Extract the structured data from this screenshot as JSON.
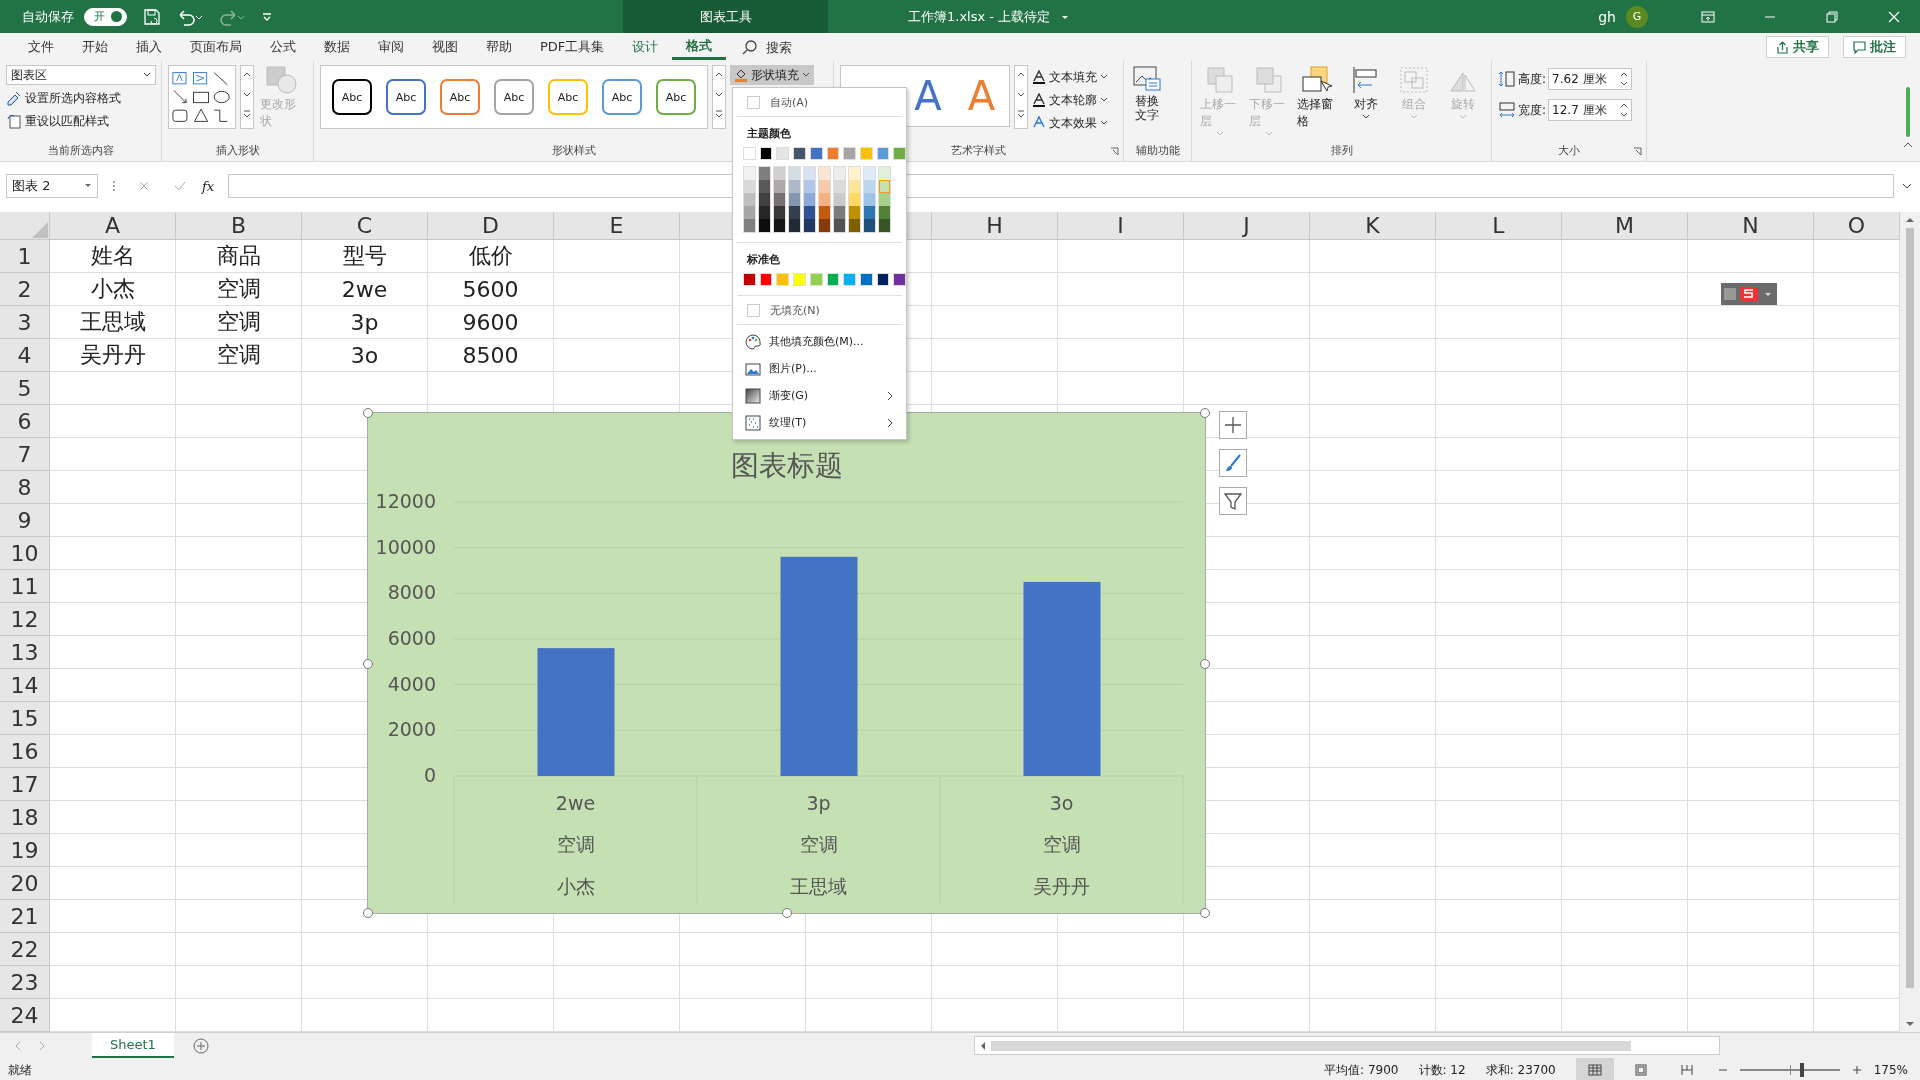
{
  "titlebar": {
    "autosave_label": "自动保存",
    "autosave": {
      "label": "开",
      "on": true
    },
    "context_label": "图表工具",
    "document_title": "工作簿1.xlsx - 上载待定",
    "user": "gh",
    "avatar": "G"
  },
  "menu_tabs": [
    {
      "label": "文件",
      "selected": false,
      "kind": "normal"
    },
    {
      "label": "开始",
      "selected": false,
      "kind": "normal"
    },
    {
      "label": "插入",
      "selected": false,
      "kind": "normal"
    },
    {
      "label": "页面布局",
      "selected": false,
      "kind": "normal"
    },
    {
      "label": "公式",
      "selected": false,
      "kind": "normal"
    },
    {
      "label": "数据",
      "selected": false,
      "kind": "normal"
    },
    {
      "label": "审阅",
      "selected": false,
      "kind": "normal"
    },
    {
      "label": "视图",
      "selected": false,
      "kind": "normal"
    },
    {
      "label": "帮助",
      "selected": false,
      "kind": "normal"
    },
    {
      "label": "PDF工具集",
      "selected": false,
      "kind": "normal"
    },
    {
      "label": "设计",
      "selected": false,
      "kind": "context"
    },
    {
      "label": "格式",
      "selected": true,
      "kind": "context"
    }
  ],
  "search": {
    "placeholder": "搜索"
  },
  "header_buttons": [
    {
      "label": "共享",
      "kind": "share"
    },
    {
      "label": "批注",
      "kind": "comment"
    }
  ],
  "ribbon": {
    "selection": {
      "dropdown": "图表区",
      "items": [
        "设置所选内容格式",
        "重设以匹配样式"
      ],
      "label": "当前所选内容"
    },
    "insert_shapes": {
      "change_shape": {
        "label": "更改形状",
        "disabled": true
      },
      "label": "插入形状"
    },
    "shape_styles": {
      "swatches": [
        {
          "label": "Abc",
          "color": "#000000"
        },
        {
          "label": "Abc",
          "color": "#4472c4"
        },
        {
          "label": "Abc",
          "color": "#ed7d31"
        },
        {
          "label": "Abc",
          "color": "#a5a5a5"
        },
        {
          "label": "Abc",
          "color": "#ffc000"
        },
        {
          "label": "Abc",
          "color": "#5b9bd5"
        },
        {
          "label": "Abc",
          "color": "#70ad47"
        }
      ],
      "fill_button": {
        "label": "形状填充",
        "expanded": true
      },
      "label": "形状样式"
    },
    "wordart": {
      "letters": [
        {
          "label": "A",
          "color": "#4472c4"
        },
        {
          "label": "A",
          "color": "#ed7d31"
        }
      ],
      "items": [
        "文本填充",
        "文本轮廓",
        "文本效果"
      ],
      "label": "艺术字样式"
    },
    "accessibility": {
      "button": "替换文字",
      "label": "辅助功能"
    },
    "arrange": {
      "buttons": [
        {
          "label": "上移一层",
          "disabled": true,
          "kind": "forward"
        },
        {
          "label": "下移一层",
          "disabled": true,
          "kind": "backward"
        },
        {
          "label": "选择窗格",
          "disabled": false,
          "kind": "pane"
        },
        {
          "label": "对齐",
          "disabled": false,
          "kind": "align"
        },
        {
          "label": "组合",
          "disabled": true,
          "kind": "group"
        },
        {
          "label": "旋转",
          "disabled": true,
          "kind": "rotate"
        }
      ],
      "label": "排列"
    },
    "size": {
      "fields": [
        {
          "label": "高度:",
          "value": "7.62 厘米",
          "kind": "height"
        },
        {
          "label": "宽度:",
          "value": "12.7 厘米",
          "kind": "width"
        }
      ],
      "label": "大小"
    }
  },
  "formula_bar": {
    "name_box": "图表 2",
    "fx": "fx"
  },
  "sheet": {
    "columns": [
      "A",
      "B",
      "C",
      "D",
      "E",
      "H",
      "I",
      "J",
      "K",
      "L",
      "M",
      "N",
      "O"
    ],
    "row_numbers": [
      "1",
      "2",
      "3",
      "4",
      "5",
      "6",
      "7",
      "8",
      "9",
      "10",
      "11",
      "12",
      "13",
      "14",
      "15",
      "16",
      "17",
      "18",
      "19",
      "20",
      "21",
      "22",
      "23",
      "24"
    ],
    "cells": [
      [
        "姓名",
        "商品",
        "型号",
        "低价"
      ],
      [
        "小杰",
        "空调",
        "2we",
        "5600"
      ],
      [
        "王思域",
        "空调",
        "3p",
        "9600"
      ],
      [
        "吴丹丹",
        "空调",
        "3o",
        "8500"
      ]
    ]
  },
  "chart": {
    "chart_data": {
      "type": "bar",
      "title": "图表标题",
      "categories": [
        "2we",
        "3p",
        "3o"
      ],
      "series": [
        {
          "color": "#4472c4",
          "values": [
            5600,
            9600,
            8500
          ]
        }
      ],
      "grid": true,
      "ylim": [
        0,
        12000
      ],
      "yticks": [
        0,
        2000,
        4000,
        6000,
        8000,
        10000,
        12000
      ]
    },
    "category_levels": [
      [
        "空调",
        "空调",
        "空调"
      ],
      [
        "小杰",
        "王思域",
        "吴丹丹"
      ]
    ]
  },
  "fill_menu": {
    "auto": "自动(A)",
    "theme_header": "主题颜色",
    "theme": [
      {
        "color": "#ffffff",
        "shades": [
          {
            "color": "#f2f2f2",
            "selected": false
          },
          {
            "color": "#d9d9d9",
            "selected": false
          },
          {
            "color": "#bfbfbf",
            "selected": false
          },
          {
            "color": "#a6a6a6",
            "selected": false
          },
          {
            "color": "#808080",
            "selected": false
          }
        ]
      },
      {
        "color": "#000000",
        "shades": [
          {
            "color": "#7f7f7f",
            "selected": false
          },
          {
            "color": "#595959",
            "selected": false
          },
          {
            "color": "#404040",
            "selected": false
          },
          {
            "color": "#262626",
            "selected": false
          },
          {
            "color": "#0d0d0d",
            "selected": false
          }
        ]
      },
      {
        "color": "#e7e6e6",
        "shades": [
          {
            "color": "#d0cece",
            "selected": false
          },
          {
            "color": "#aeaaaa",
            "selected": false
          },
          {
            "color": "#757171",
            "selected": false
          },
          {
            "color": "#3a3838",
            "selected": false
          },
          {
            "color": "#171616",
            "selected": false
          }
        ]
      },
      {
        "color": "#44546a",
        "shades": [
          {
            "color": "#d6dce4",
            "selected": false
          },
          {
            "color": "#adb9ca",
            "selected": false
          },
          {
            "color": "#8497b0",
            "selected": false
          },
          {
            "color": "#333f4f",
            "selected": false
          },
          {
            "color": "#222a35",
            "selected": false
          }
        ]
      },
      {
        "color": "#4472c4",
        "shades": [
          {
            "color": "#d9e2f3",
            "selected": false
          },
          {
            "color": "#b4c6e7",
            "selected": false
          },
          {
            "color": "#8eaadb",
            "selected": false
          },
          {
            "color": "#2f5496",
            "selected": false
          },
          {
            "color": "#1f3864",
            "selected": false
          }
        ]
      },
      {
        "color": "#ed7d31",
        "shades": [
          {
            "color": "#fbe5d5",
            "selected": false
          },
          {
            "color": "#f7caac",
            "selected": false
          },
          {
            "color": "#f4b183",
            "selected": false
          },
          {
            "color": "#c55a11",
            "selected": false
          },
          {
            "color": "#843c0c",
            "selected": false
          }
        ]
      },
      {
        "color": "#a5a5a5",
        "shades": [
          {
            "color": "#ededed",
            "selected": false
          },
          {
            "color": "#dbdbdb",
            "selected": false
          },
          {
            "color": "#c9c9c9",
            "selected": false
          },
          {
            "color": "#7b7b7b",
            "selected": false
          },
          {
            "color": "#525252",
            "selected": false
          }
        ]
      },
      {
        "color": "#ffc000",
        "shades": [
          {
            "color": "#fff2cc",
            "selected": false
          },
          {
            "color": "#ffe599",
            "selected": false
          },
          {
            "color": "#ffd966",
            "selected": false
          },
          {
            "color": "#bf9000",
            "selected": false
          },
          {
            "color": "#7f6000",
            "selected": false
          }
        ]
      },
      {
        "color": "#5b9bd5",
        "shades": [
          {
            "color": "#deebf6",
            "selected": false
          },
          {
            "color": "#bdd7ee",
            "selected": false
          },
          {
            "color": "#9dc3e6",
            "selected": false
          },
          {
            "color": "#2e75b5",
            "selected": false
          },
          {
            "color": "#1e4e79",
            "selected": false
          }
        ]
      },
      {
        "color": "#70ad47",
        "shades": [
          {
            "color": "#e2efd9",
            "selected": false
          },
          {
            "color": "#c5e0b3",
            "selected": true
          },
          {
            "color": "#a8d08d",
            "selected": false
          },
          {
            "color": "#538135",
            "selected": false
          },
          {
            "color": "#375623",
            "selected": false
          }
        ]
      }
    ],
    "standard_header": "标准色",
    "standard": [
      {
        "color": "#c00000"
      },
      {
        "color": "#ff0000"
      },
      {
        "color": "#ffc000"
      },
      {
        "color": "#ffff00"
      },
      {
        "color": "#92d050"
      },
      {
        "color": "#00b050"
      },
      {
        "color": "#00b0f0"
      },
      {
        "color": "#0070c0"
      },
      {
        "color": "#002060"
      },
      {
        "color": "#7030a0"
      }
    ],
    "no_fill": "无填充(N)",
    "items": [
      {
        "label": "其他填充颜色(M)...",
        "kind": "palette"
      },
      {
        "label": "图片(P)...",
        "kind": "picture"
      },
      {
        "label": "渐变(G)",
        "kind": "gradient"
      },
      {
        "label": "纹理(T)",
        "kind": "texture"
      }
    ]
  },
  "sheet_tabs": [
    {
      "label": "Sheet1",
      "selected": true
    }
  ],
  "status_bar": {
    "ready": "就绪",
    "stats": [
      "平均值: 7900",
      "计数: 12",
      "求和: 23700"
    ],
    "views": [
      {
        "kind": "normal",
        "selected": true
      },
      {
        "kind": "layout",
        "selected": false
      },
      {
        "kind": "pagebreak",
        "selected": false
      }
    ],
    "zoom_slider": {
      "level": 0.62
    },
    "zoom": "175%"
  }
}
